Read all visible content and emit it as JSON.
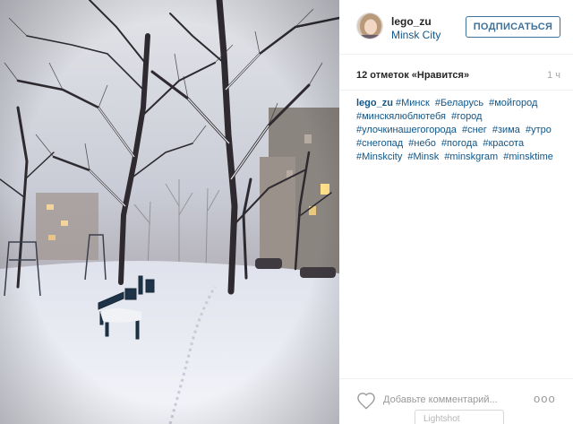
{
  "post": {
    "username": "lego_zu",
    "location": "Minsk City",
    "follow_label": "ПОДПИСАТЬСЯ",
    "likes": "12 отметок «Нравится»",
    "time": "1 ч",
    "caption": {
      "author": "lego_zu",
      "hashtags": [
        "#Минск",
        "#Беларусь",
        "#мойгород",
        "#минскялюблютебя",
        "#город",
        "#улочкинашегогорода",
        "#снег",
        "#зима",
        "#утро",
        "#снегопад",
        "#небо",
        "#погода",
        "#красота",
        "#Minskcity",
        "#Minsk",
        "#minskgram",
        "#minsktime"
      ]
    },
    "comment_placeholder": "Добавьте комментарий...",
    "more_label": "ooo"
  },
  "overlay": {
    "lightshot_label": "Lightshot"
  },
  "icons": {
    "heart": "heart-icon",
    "more": "more-options-icon"
  },
  "colors": {
    "link": "#125688",
    "follow": "#3f729b",
    "text": "#262626",
    "muted": "#a5a7aa"
  }
}
